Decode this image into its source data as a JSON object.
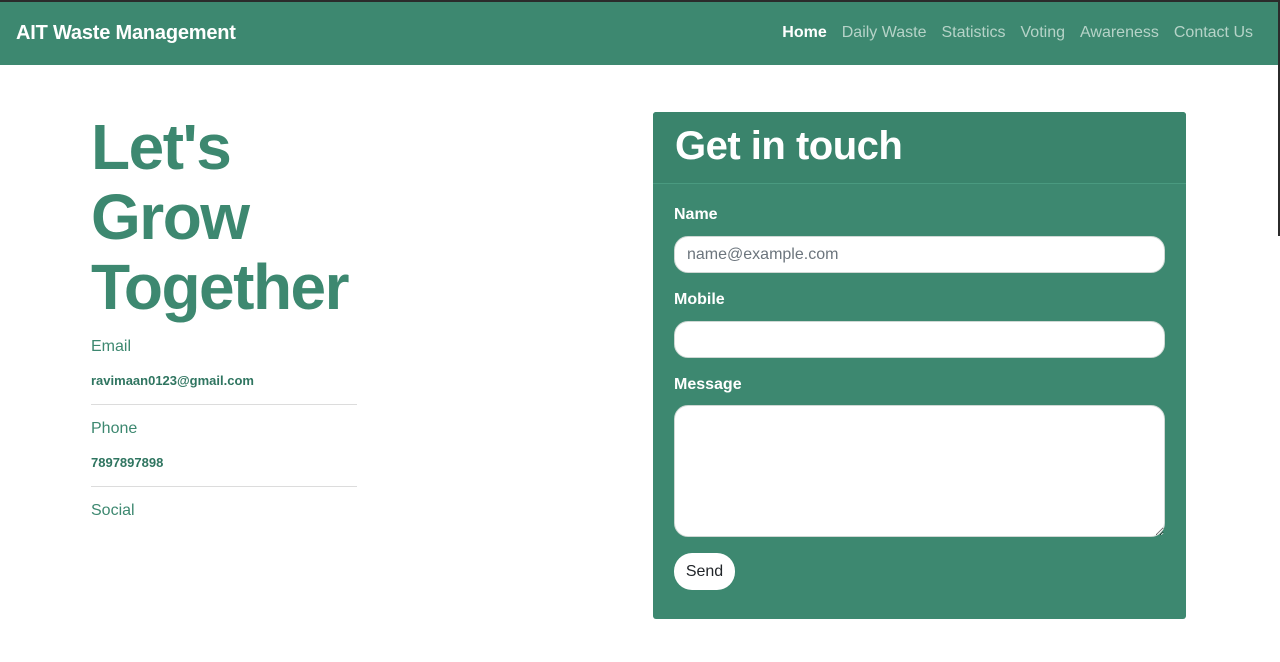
{
  "navbar": {
    "brand": "AIT Waste Management",
    "links": [
      {
        "label": "Home",
        "active": true
      },
      {
        "label": "Daily Waste",
        "active": false
      },
      {
        "label": "Statistics",
        "active": false
      },
      {
        "label": "Voting",
        "active": false
      },
      {
        "label": "Awareness",
        "active": false
      },
      {
        "label": "Contact Us",
        "active": false
      }
    ]
  },
  "hero": {
    "line1": "Let's",
    "line2": "Grow",
    "line3": "Together"
  },
  "contact_info": {
    "email_label": "Email",
    "email_value": "ravimaan0123@gmail.com",
    "phone_label": "Phone",
    "phone_value": "7897897898",
    "social_label": "Social"
  },
  "form": {
    "title": "Get in touch",
    "name_label": "Name",
    "name_placeholder": "name@example.com",
    "mobile_label": "Mobile",
    "message_label": "Message",
    "send_label": "Send"
  },
  "colors": {
    "brand_green": "#3d8870",
    "nav_inactive": "#b6d3c8"
  }
}
